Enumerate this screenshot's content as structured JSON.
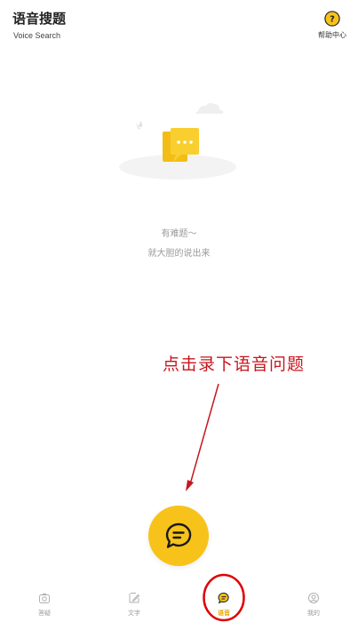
{
  "header": {
    "title": "语音搜题",
    "subtitle": "Voice Search",
    "help_label": "帮助中心"
  },
  "empty_state": {
    "line1": "有难题～",
    "line2": "就大胆的说出来"
  },
  "annotation": {
    "text": "点击录下语音问题",
    "color": "#c8161d"
  },
  "record_button": {
    "icon": "chat-bubble-icon",
    "color": "#f7c31b"
  },
  "tabbar": {
    "tabs": [
      {
        "label": "答疑",
        "icon": "camera-icon",
        "active": false
      },
      {
        "label": "文字",
        "icon": "edit-icon",
        "active": false
      },
      {
        "label": "语音",
        "icon": "voice-chat-icon",
        "active": true
      },
      {
        "label": "我的",
        "icon": "profile-icon",
        "active": false
      }
    ]
  },
  "colors": {
    "accent": "#f7c31b",
    "active_tab": "#e8a800",
    "muted_text": "#9a9a9a"
  }
}
